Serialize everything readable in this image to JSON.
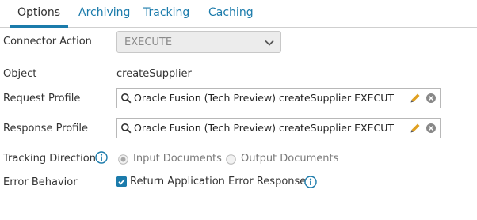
{
  "tabs": [
    {
      "label": "Options",
      "active": true
    },
    {
      "label": "Archiving",
      "active": false
    },
    {
      "label": "Tracking",
      "active": false
    },
    {
      "label": "Caching",
      "active": false
    }
  ],
  "connector_action": {
    "label": "Connector Action",
    "value": "EXECUTE",
    "icon": "chevron-down-icon"
  },
  "object": {
    "label": "Object",
    "value": "createSupplier"
  },
  "request_profile": {
    "label": "Request Profile",
    "value": "Oracle Fusion (Tech Preview) createSupplier EXECUTE Re"
  },
  "response_profile": {
    "label": "Response Profile",
    "value": "Oracle Fusion (Tech Preview) createSupplier EXECUTE Re"
  },
  "tracking_direction": {
    "label": "Tracking Direction",
    "options": [
      {
        "label": "Input Documents",
        "selected": true
      },
      {
        "label": "Output Documents",
        "selected": false
      }
    ]
  },
  "error_behavior": {
    "label": "Error Behavior",
    "checkbox_label": "Return Application Error Responses",
    "checked": true
  },
  "colors": {
    "accent": "#1b7bab",
    "pencil": "#e0a020",
    "text": "#333333",
    "disabled_text": "#7a7a7a"
  }
}
